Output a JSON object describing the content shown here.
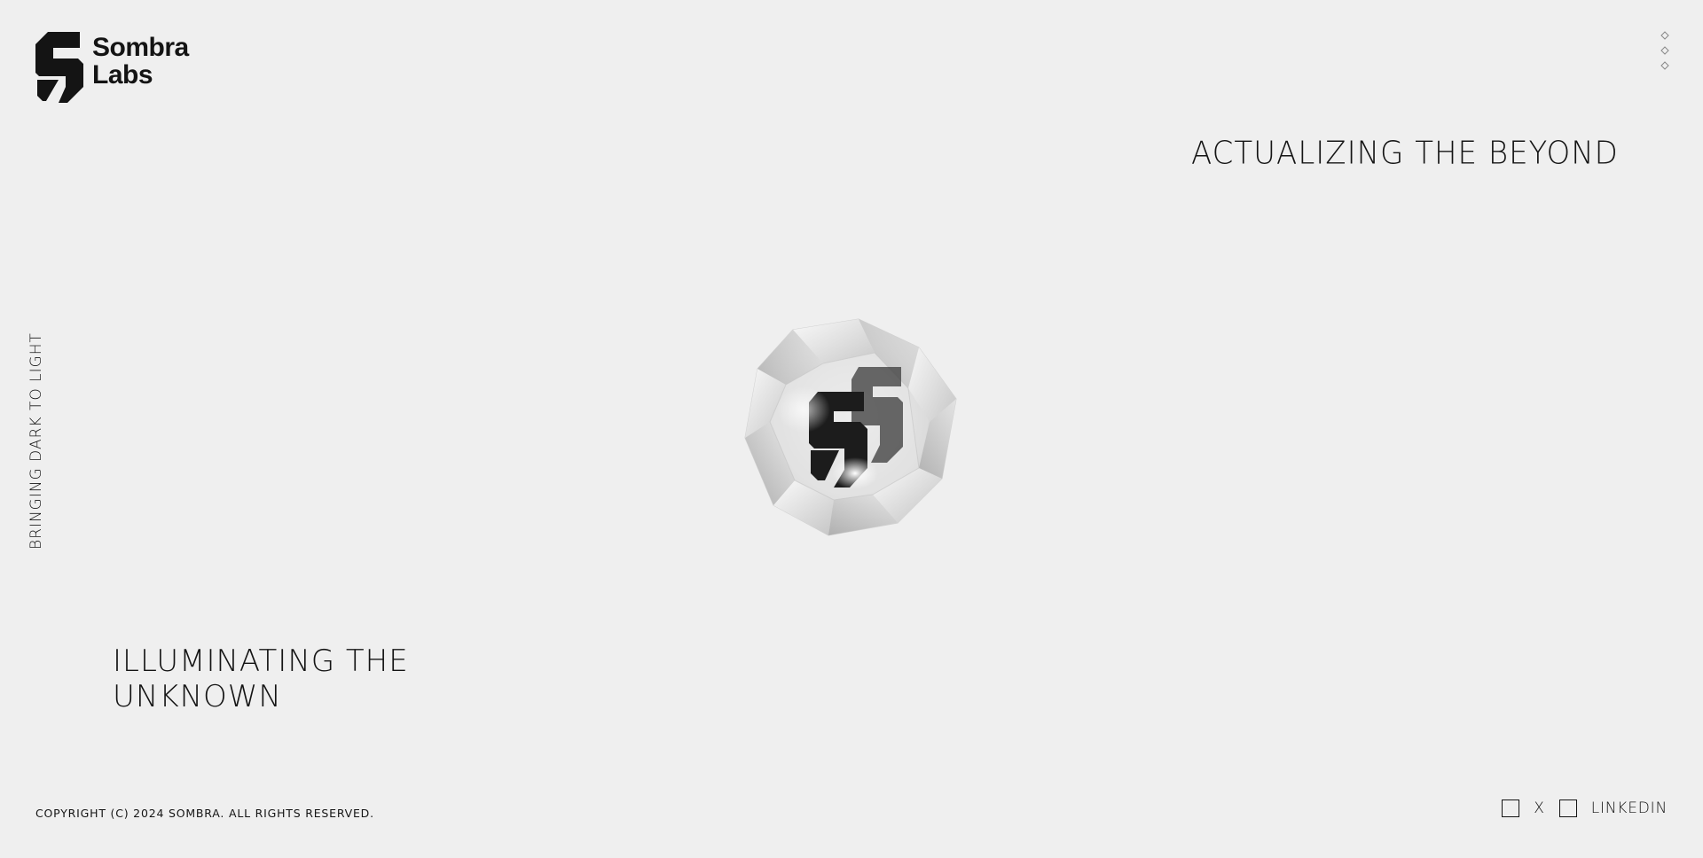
{
  "brand": {
    "name_line1": "Sombra",
    "name_line2": "Labs",
    "logo_icon": "sombra-s-logo-icon"
  },
  "menu": {
    "icon": "three-diamonds-menu-icon"
  },
  "hero": {
    "headline_right": "ACTUALIZING THE BEYOND",
    "side_text": "BRINGING DARK TO LIGHT",
    "headline_left": "ILLUMINATING THE UNKNOWN",
    "center_visual": "crystal-dodecahedron-with-s-logo"
  },
  "footer": {
    "copyright": "COPYRIGHT (C) 2024 SOMBRA. ALL RIGHTS RESERVED.",
    "social": [
      {
        "label": "X",
        "icon": "square-icon"
      },
      {
        "label": "LINKEDIN",
        "icon": "square-icon"
      }
    ]
  },
  "colors": {
    "background": "#efefef",
    "text": "#141414"
  }
}
